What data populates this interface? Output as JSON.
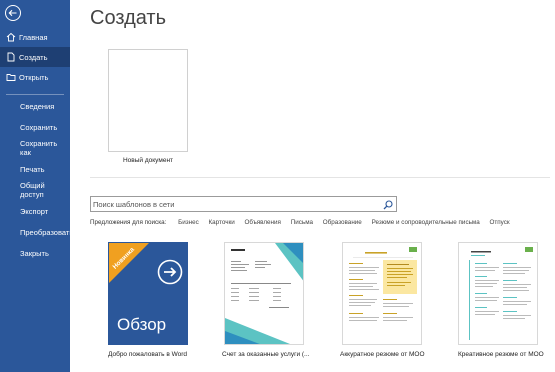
{
  "nav": {
    "home": "Главная",
    "create": "Создать",
    "open": "Открыть",
    "info": "Сведения",
    "save": "Сохранить",
    "save_as": "Сохранить как",
    "print": "Печать",
    "share": "Общий доступ",
    "export": "Экспорт",
    "transform": "Преобразовать",
    "close": "Закрыть"
  },
  "main": {
    "title": "Создать",
    "blank_doc_label": "Новый документ",
    "search_placeholder": "Поиск шаблонов в сети",
    "suggest_label": "Предложения для поиска:",
    "suggestions": [
      "Бизнес",
      "Карточки",
      "Объявления",
      "Письма",
      "Образование",
      "Резюме и сопроводительные письма",
      "Отпуск"
    ]
  },
  "templates": [
    {
      "label": "Добро пожаловать в Word",
      "badge": "Новинка",
      "big_text": "Обзор"
    },
    {
      "label": "Счет за оказанные услуги (..."
    },
    {
      "label": "Аккуратное резюме от MOO"
    },
    {
      "label": "Креативное резюме от MOO"
    }
  ],
  "colors": {
    "sidebar": "#2b579a",
    "sidebar_active": "#1e3f73",
    "badge": "#f0a020"
  }
}
